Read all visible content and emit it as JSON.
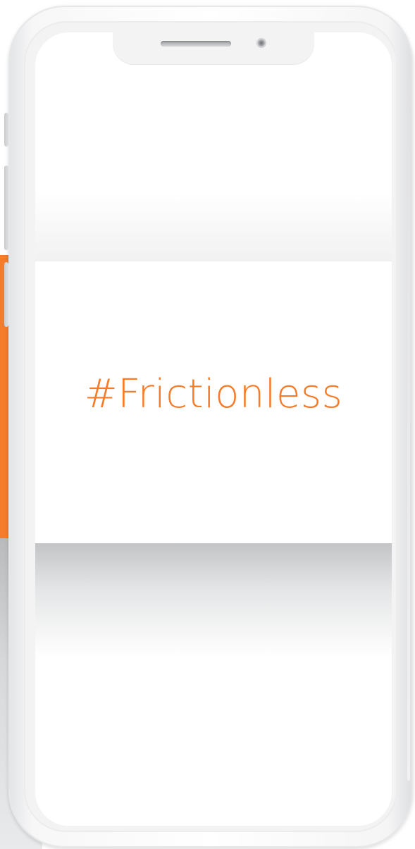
{
  "screen": {
    "hashtag": "#Frictionless"
  },
  "colors": {
    "accent": "#f47c2a",
    "frame": "#f3f3f4"
  },
  "icons": {
    "speaker": "speaker-icon",
    "camera": "camera-icon"
  }
}
